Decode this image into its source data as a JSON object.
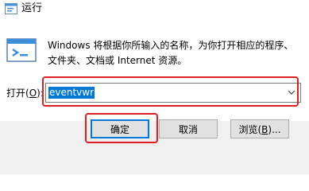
{
  "window": {
    "title": "运行",
    "icon": "run-dialog-icon"
  },
  "description": {
    "line1": "Windows 将根据你所输入的名称，为你打开相应的程序、",
    "line2": "文件夹、文档或 Internet 资源。"
  },
  "open": {
    "label_prefix": "打开(",
    "label_hotkey": "O",
    "label_suffix": "):",
    "value": "eventvwr"
  },
  "buttons": {
    "ok": "确定",
    "cancel": "取消",
    "browse_prefix": "浏览(",
    "browse_hotkey": "B",
    "browse_suffix": ")..."
  },
  "colors": {
    "accent": "#0078d7",
    "highlight": "#e02020",
    "footer_bg": "#f0f0f0"
  }
}
